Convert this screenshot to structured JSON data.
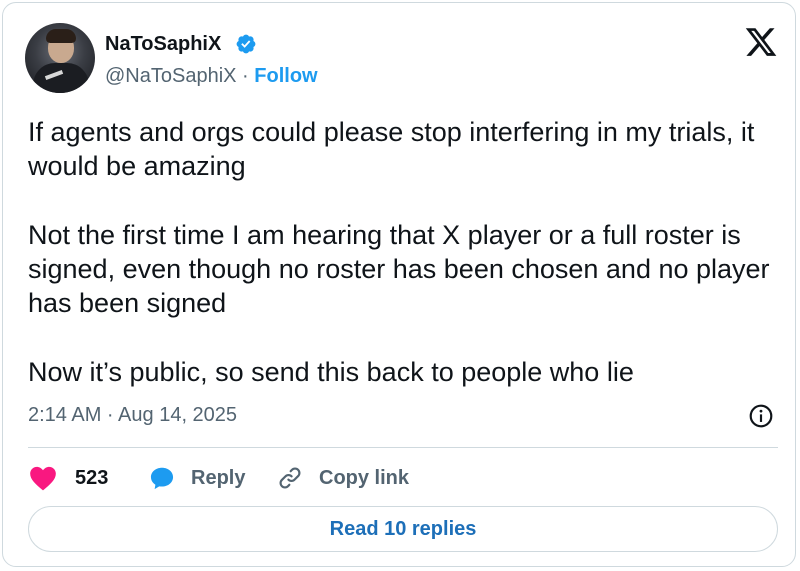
{
  "author": {
    "name": "NaToSaphiX",
    "handle": "@NaToSaphiX",
    "separator": " · ",
    "follow_label": "Follow"
  },
  "tweet": {
    "paragraphs": [
      "If agents and orgs could please stop interfering in my trials, it would be amazing",
      "Not the first time I am hearing that X player or a full roster is signed, even though no roster has been chosen and no player has been signed",
      "Now it’s public, so send this back to people who lie"
    ],
    "timestamp": "2:14 AM · Aug 14, 2025"
  },
  "actions": {
    "like_count": "523",
    "reply_label": "Reply",
    "copy_label": "Copy link"
  },
  "read_replies_label": "Read 10 replies",
  "icons": {
    "verified": "verified-badge-icon",
    "x": "x-logo-icon",
    "info": "info-icon",
    "like": "heart-icon",
    "reply": "speech-bubble-icon",
    "copy": "link-icon"
  },
  "colors": {
    "accent": "#1d9bf0",
    "heart": "#f91880",
    "text_primary": "#0f1419",
    "text_secondary": "#536471",
    "border": "#cfd9de",
    "read_replies_text": "#1d6fb8"
  }
}
